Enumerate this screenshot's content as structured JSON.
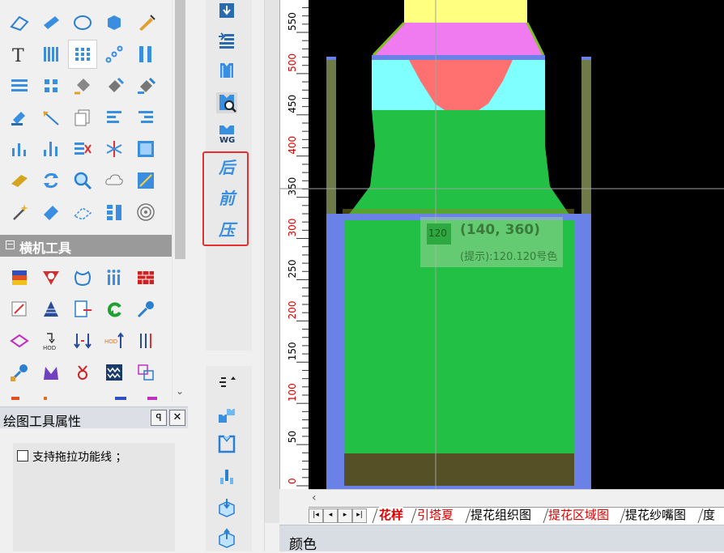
{
  "left_palette": {
    "section_title": "横机工具"
  },
  "tool_props": {
    "title": "绘图工具属性",
    "pin_label": "ꟼ",
    "close_label": "✕",
    "checkbox_label": "支持拖拉功能线 ；"
  },
  "right_tools": {
    "back_label": "后",
    "front_label": "前",
    "press_label": "压",
    "wg_label": "WG"
  },
  "ruler": {
    "ticks": [
      "0",
      "50",
      "100",
      "150",
      "200",
      "250",
      "300",
      "350",
      "400",
      "450",
      "500",
      "550"
    ],
    "red_ticks": [
      "0",
      "100",
      "200",
      "300",
      "400",
      "500"
    ]
  },
  "canvas": {
    "cursor_label": "120",
    "tooltip_coords": "(140, 360)",
    "tooltip_hint": "(提示):120.120号色"
  },
  "tabs": [
    {
      "label": "花样",
      "active": true,
      "red": true
    },
    {
      "label": "引塔夏",
      "active": false,
      "red": true
    },
    {
      "label": "提花组织图",
      "active": false,
      "red": false
    },
    {
      "label": "提花区域图",
      "active": false,
      "red": true
    },
    {
      "label": "提花纱嘴图",
      "active": false,
      "red": false
    },
    {
      "label": "度目",
      "active": false,
      "red": false
    }
  ],
  "status": {
    "color_panel_title": "颜色"
  },
  "colors": {
    "green": "#22c044",
    "blue": "#6a82e8",
    "cyan": "#7fffff",
    "pink": "#f07bf0",
    "yellow": "#ffff80",
    "salmon": "#ff7070",
    "olive": "#6e7a48",
    "dark": "#555025",
    "highlight": "#e53030"
  }
}
